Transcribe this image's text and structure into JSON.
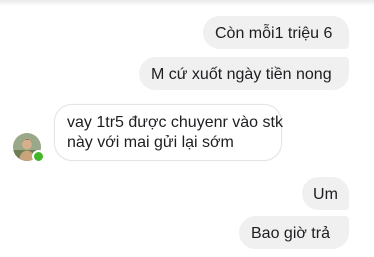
{
  "conversation": {
    "messages": [
      {
        "sender": "me",
        "lines": [
          "Còn mỗi1 triệu 6"
        ]
      },
      {
        "sender": "me",
        "lines": [
          "M cứ xuốt ngày tiền nong"
        ]
      },
      {
        "sender": "contact",
        "lines": [
          "vay 1tr5 được chuyenr vào stk",
          "này với mai gửi lại sớm"
        ]
      },
      {
        "sender": "me",
        "lines": [
          "Um"
        ]
      },
      {
        "sender": "me",
        "lines": [
          "Bao giờ trả"
        ]
      }
    ]
  },
  "contact": {
    "avatar_icon": "person-photo-icon",
    "online_indicator_color": "#42b72a"
  },
  "colors": {
    "outgoing_bubble": "#f1f0f0",
    "incoming_bubble": "#ffffff",
    "text": "#1c1e21"
  }
}
